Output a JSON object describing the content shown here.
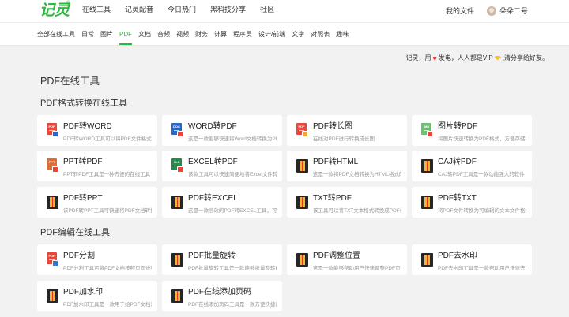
{
  "logo": {
    "text": "记灵",
    "reg": "®",
    "color": "#2db83d"
  },
  "topnav": {
    "items": [
      "在线工具",
      "记灵配音",
      "今日热门",
      "黑科技分享",
      "社区"
    ]
  },
  "user": {
    "my_files": "我的文件",
    "name": "朵朵二号"
  },
  "categories": {
    "items": [
      "全部在线工具",
      "日常",
      "图片",
      "PDF",
      "文档",
      "音频",
      "视频",
      "财务",
      "计算",
      "程序员",
      "设计/前端",
      "文字",
      "对照表",
      "趣味"
    ],
    "active": "PDF"
  },
  "notice": {
    "part1": "记灵，用",
    "part2": "发电，人人都是VIP",
    "part3": ",清分享给好友。"
  },
  "page_title": "PDF在线工具",
  "sections": [
    {
      "title": "PDF格式转换在线工具",
      "tools": [
        {
          "name": "PDF转WORD",
          "desc": "PDF转WORD工具可以将PDF文件格式转换为WORD格式",
          "icon": "pdf-to-word-icon"
        },
        {
          "name": "WORD转PDF",
          "desc": "这是一款能够快速将Word文档转换为PDF格式",
          "icon": "word-to-pdf-icon"
        },
        {
          "name": "PDF转长图",
          "desc": "在线对PDF进行转换成长图",
          "icon": "pdf-to-image-icon"
        },
        {
          "name": "图片转PDF",
          "desc": "将图片快速转换为PDF格式，方便存储和分享",
          "icon": "image-to-pdf-icon"
        },
        {
          "name": "PPT转PDF",
          "desc": "PPT转PDF工具是一种方便的在线工具",
          "icon": "ppt-to-pdf-icon"
        },
        {
          "name": "EXCEL转PDF",
          "desc": "该款工具可以快速简便地将Excel文件转换",
          "icon": "excel-to-pdf-icon"
        },
        {
          "name": "PDF转HTML",
          "desc": "这是一款将PDF文档转换为HTML格式的工具",
          "icon": "pdf-to-html-icon"
        },
        {
          "name": "CAJ转PDF",
          "desc": "CAJ转PDF工具是一款功能强大的软件",
          "icon": "caj-to-pdf-icon"
        },
        {
          "name": "PDF转PPT",
          "desc": "该PDF转PPT工具可快速将PDF文档转换",
          "icon": "pdf-to-ppt-icon"
        },
        {
          "name": "PDF转EXCEL",
          "desc": "这是一款高效的PDF转EXCEL工具，可以轻松转换",
          "icon": "pdf-to-excel-icon"
        },
        {
          "name": "TXT转PDF",
          "desc": "该工具可以将TXT文本格式转换成PDF格式",
          "icon": "txt-to-pdf-icon"
        },
        {
          "name": "PDF转TXT",
          "desc": "将PDF文件转换为可编辑的文本文件格式",
          "icon": "pdf-to-txt-icon"
        }
      ]
    },
    {
      "title": "PDF编辑在线工具",
      "tools": [
        {
          "name": "PDF分割",
          "desc": "PDF分割工具可将PDF文档按照页面进行分割",
          "icon": "pdf-split-icon"
        },
        {
          "name": "PDF批量旋转",
          "desc": "PDF批量旋转工具是一款能够批量旋转PDF页面",
          "icon": "pdf-rotate-icon"
        },
        {
          "name": "PDF调整位置",
          "desc": "这是一款能够帮助用户快速调整PDF页面位置",
          "icon": "pdf-reorder-icon"
        },
        {
          "name": "PDF去水印",
          "desc": "PDF去水印工具是一款帮助用户快速去除水印",
          "icon": "pdf-remove-watermark-icon"
        },
        {
          "name": "PDF加水印",
          "desc": "PDF加水印工具是一款用于给PDF文档添加水印",
          "icon": "pdf-add-watermark-icon"
        },
        {
          "name": "PDF在线添加页码",
          "desc": "PDF在线添加页码工具是一款方便快捷的工具",
          "icon": "pdf-page-number-icon"
        }
      ]
    }
  ],
  "colors": {
    "accent": "#2db83d",
    "pdf_red": "#e8463a",
    "word_blue": "#2b67c6",
    "excel_green": "#1e8e4a",
    "ppt_orange": "#e36b2c",
    "book_gold": "#f1b532"
  }
}
